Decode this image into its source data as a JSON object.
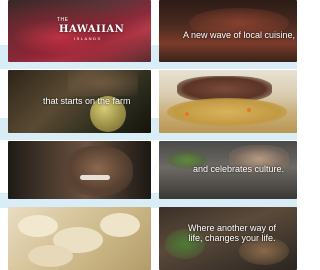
{
  "tiles": [
    {
      "name": "tile-raspberries-logo",
      "caption": ""
    },
    {
      "name": "tile-steak-dish",
      "caption": "A new wave of local cuisine,"
    },
    {
      "name": "tile-farm-coconut",
      "caption": "that starts on the farm"
    },
    {
      "name": "tile-plated-meal",
      "caption": ""
    },
    {
      "name": "tile-chef-smiling",
      "caption": ""
    },
    {
      "name": "tile-garnishing-dish",
      "caption": "and celebrates culture."
    },
    {
      "name": "tile-sliced-fruit",
      "caption": ""
    },
    {
      "name": "tile-feast-bowls",
      "caption": "Where another way of life, changes your life."
    }
  ],
  "logo": {
    "small": "THE",
    "main": "HAWAIIAN",
    "sub": "ISLANDS"
  },
  "colors": {
    "band": "#d9edf7",
    "caption": "#ffffff"
  }
}
